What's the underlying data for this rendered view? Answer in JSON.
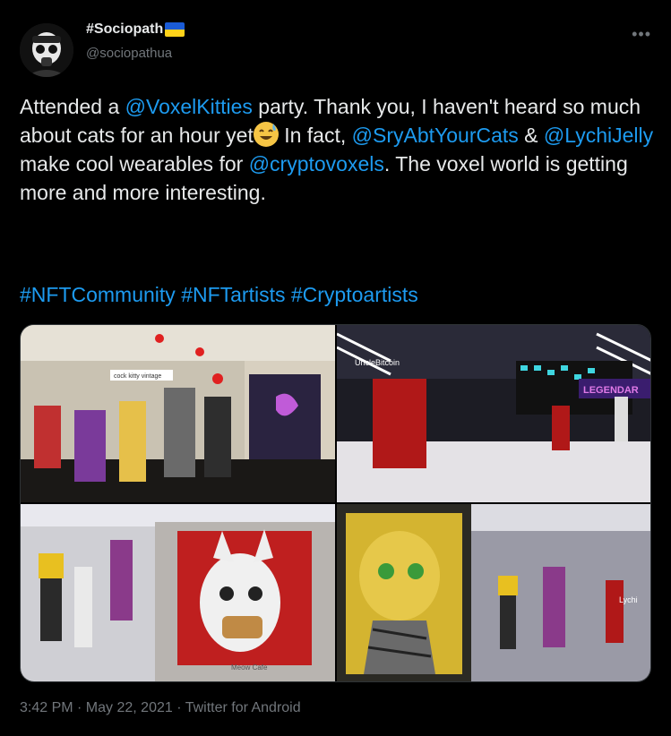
{
  "user": {
    "display_name": "#Sociopath",
    "handle": "@sociopathua",
    "flag_colors": {
      "top": "#1a5bd6",
      "bottom": "#ffd21a"
    }
  },
  "more_icon": "more-horizontal-icon",
  "tweet": {
    "p1": "Attended a ",
    "m1": "@VoxelKitties",
    "p2": " party. Thank you, I haven't heard so much about cats for an hour yet",
    "p3": " In fact, ",
    "m2": "@SryAbtYourCats",
    "p4": " & ",
    "m3": "@LychiJelly",
    "p5": " make cool wearables for ",
    "m4": "@cryptovoxels",
    "p6": ". The voxel world is getting more and more interesting.",
    "hashtags": "#NFTCommunity #NFTartists #Cryptoartists"
  },
  "media": {
    "img1_label": "cock kitty vintage",
    "img2_label": "UncleBitcoin",
    "img2_sign": "LEGENDAR",
    "img3_label": "Meow Cafe",
    "img4_label": "Lychi"
  },
  "meta": "3:42 PM · May 22, 2021 · Twitter for Android",
  "colors": {
    "link": "#1d9bf0",
    "muted": "#71767b",
    "text": "#e7e9ea"
  }
}
